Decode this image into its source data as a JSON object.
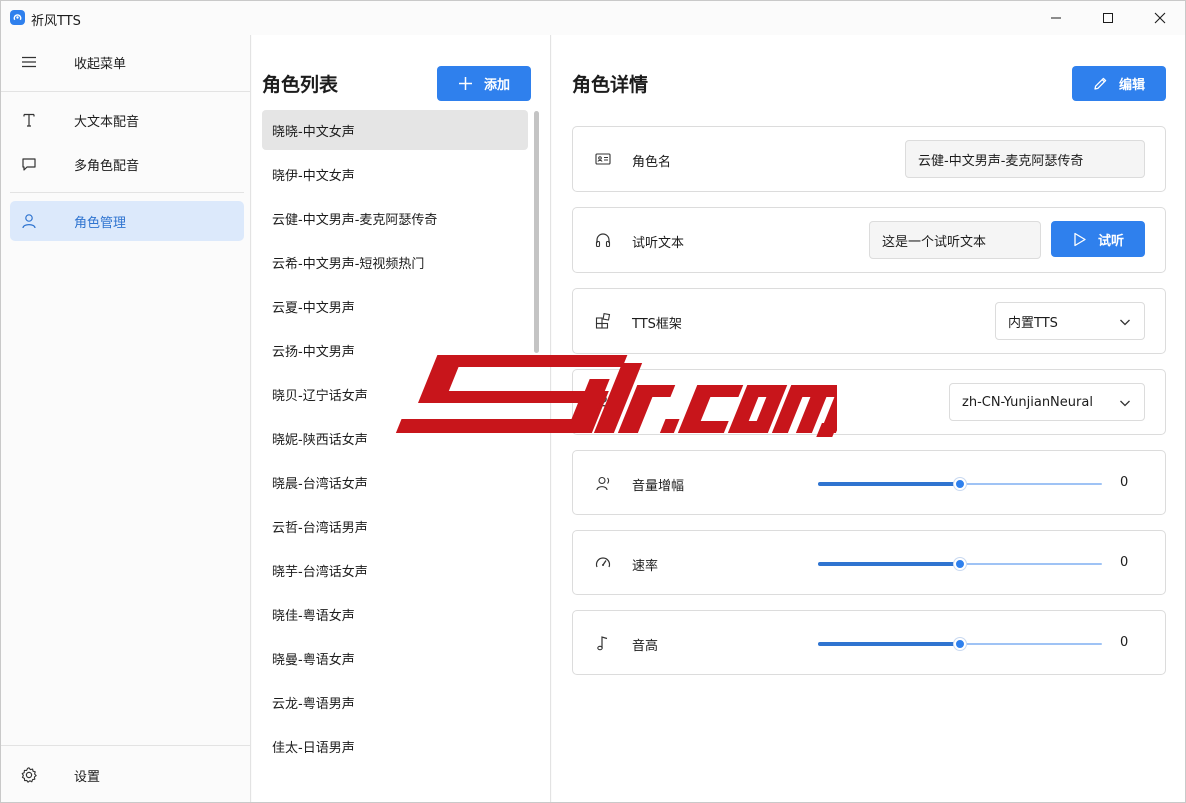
{
  "app": {
    "title": "祈风TTS"
  },
  "colors": {
    "accent": "#2f80ed",
    "selected_nav_bg": "#dce9fb",
    "watermark_red": "#c8151b"
  },
  "sidebar": {
    "items": [
      {
        "label": "收起菜单",
        "icon": "hamburger-menu-icon"
      },
      {
        "label": "大文本配音",
        "icon": "text-icon"
      },
      {
        "label": "多角色配音",
        "icon": "chat-bubble-icon"
      },
      {
        "label": "角色管理",
        "icon": "person-icon",
        "active": true
      }
    ],
    "settings_label": "设置"
  },
  "role_list": {
    "title": "角色列表",
    "add_label": "添加",
    "items": [
      "晓晓-中文女声",
      "晓伊-中文女声",
      "云健-中文男声-麦克阿瑟传奇",
      "云希-中文男声-短视频热门",
      "云夏-中文男声",
      "云扬-中文男声",
      "晓贝-辽宁话女声",
      "晓妮-陕西话女声",
      "晓晨-台湾话女声",
      "云哲-台湾话男声",
      "晓芋-台湾话女声",
      "晓佳-粤语女声",
      "晓曼-粤语女声",
      "云龙-粤语男声",
      "佳太-日语男声"
    ],
    "selected_index": 0
  },
  "details": {
    "title": "角色详情",
    "edit_label": "编辑",
    "role_name": {
      "label": "角色名",
      "value": "云健-中文男声-麦克阿瑟传奇"
    },
    "preview_text": {
      "label": "试听文本",
      "value": "这是一个试听文本",
      "button_label": "试听"
    },
    "tts_framework": {
      "label": "TTS框架",
      "value": "内置TTS"
    },
    "voice": {
      "value": "zh-CN-YunjianNeural"
    },
    "volume": {
      "label": "音量增幅",
      "value": "0",
      "fraction": 0.5
    },
    "rate": {
      "label": "速率",
      "value": "0",
      "fraction": 0.5
    },
    "pitch": {
      "label": "音高",
      "value": "0",
      "fraction": 0.5
    }
  },
  "watermark": {
    "text": "Silr.com"
  }
}
